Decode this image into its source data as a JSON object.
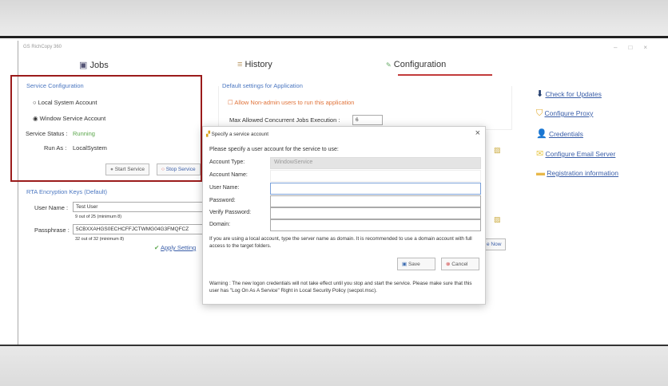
{
  "app": {
    "title": "GS RichCopy 360"
  },
  "tabs": [
    {
      "label": "Jobs"
    },
    {
      "label": "History"
    },
    {
      "label": "Configuration"
    }
  ],
  "service": {
    "heading": "Service Configuration",
    "local": "Local System Account",
    "window": "Window Service Account",
    "status_label": "Service Status :",
    "status_value": "Running",
    "runas_label": "Run As :",
    "runas_value": "LocalSystem",
    "start": "Start Service",
    "stop": "Stop Service"
  },
  "rta": {
    "heading": "RTA Encryption Keys (Default)",
    "user_label": "User Name :",
    "user_value": "Test User",
    "user_hint": "9 out of 25 (minimum 8)",
    "pass_label": "Passphrase :",
    "pass_value": "5CBXXAHGS0ECHCFFJCTWMG04G3FMQFCZ",
    "pass_hint": "32 out of 32 (minimum 8)",
    "apply": "Apply Setting"
  },
  "defaults": {
    "heading": "Default settings for Application",
    "allow": "Allow Non-admin users to run this application",
    "max_label": "Max Allowed Concurrent Jobs Execution :",
    "max_value": "6",
    "partial_button": "e Now"
  },
  "links": [
    "Check for Updates",
    "Configure Proxy",
    "Credentials",
    "Configure Email Server",
    "Registration information"
  ],
  "dialog": {
    "title": "Specify a service account",
    "prompt": "Please specify a user account for the service to use:",
    "account_type_label": "Account Type:",
    "account_type_value": "WindowService",
    "account_name_label": "Account Name:",
    "user_label": "User Name:",
    "password_label": "Password:",
    "verify_label": "Verify Password:",
    "domain_label": "Domain:",
    "info": "If you are using a local account, type the server name as domain. It is recommended to use a domain account with full access to the target folders.",
    "save": "Save",
    "cancel": "Cancel",
    "warning": "Warning : The new logon credentials will not take effect until you stop and start the service. Please make sure that this user has \"Log On As A Service\" Right in Local Security Policy (secpol.msc).",
    "close": "×"
  }
}
